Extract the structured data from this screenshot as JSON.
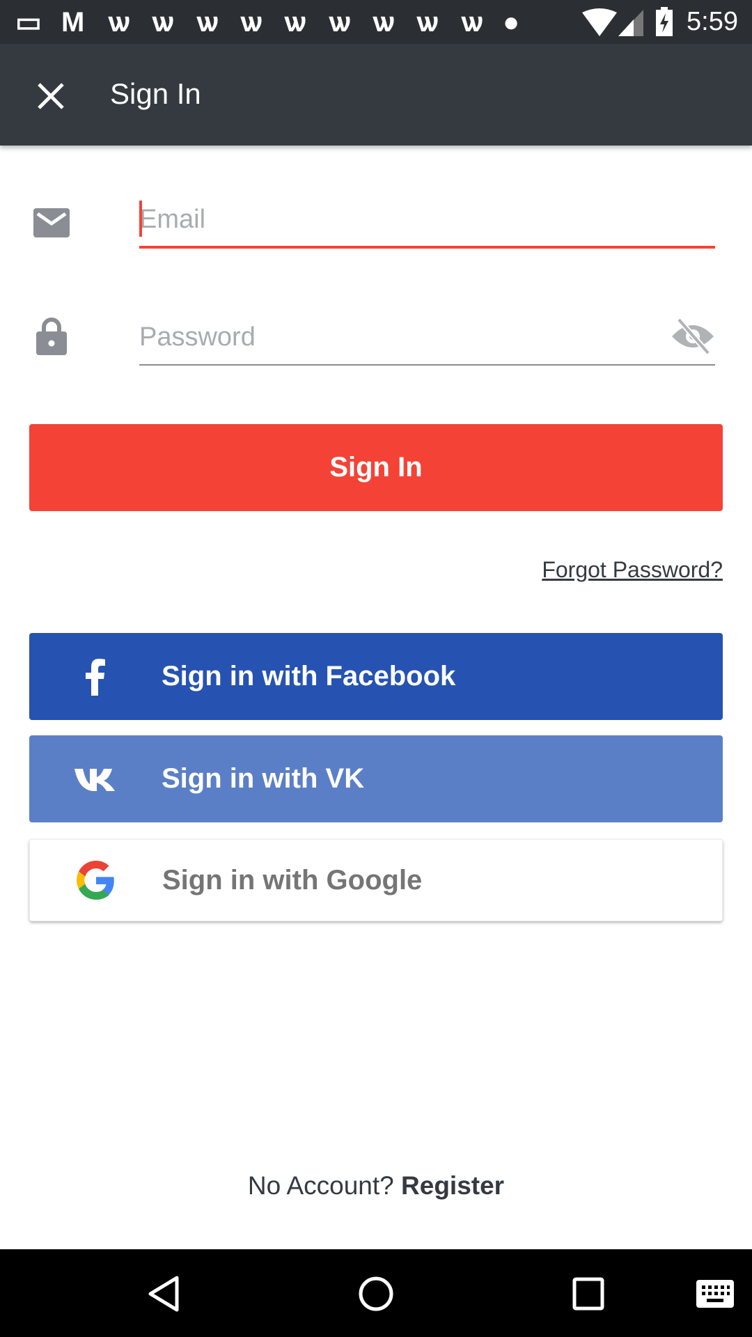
{
  "status_bar": {
    "time": "5:59",
    "icons": [
      "messages-icon",
      "gmail-icon",
      "app-w-icon",
      "app-w-icon",
      "app-w-icon",
      "app-w-icon",
      "app-w-icon",
      "app-w-icon",
      "app-w-icon",
      "app-w-icon",
      "app-w-icon",
      "chat-icon",
      "wifi-icon",
      "signal-icon",
      "battery-charging-icon"
    ]
  },
  "toolbar": {
    "title": "Sign In",
    "close_icon": "close-icon"
  },
  "form": {
    "email_placeholder": "Email",
    "password_placeholder": "Password",
    "signin_label": "Sign In",
    "forgot_label": "Forgot Password?"
  },
  "social": {
    "facebook_label": "Sign in with Facebook",
    "vk_label": "Sign in with VK",
    "google_label": "Sign in with Google"
  },
  "footer": {
    "no_account": "No Account?",
    "register": "Register"
  },
  "colors": {
    "accent": "#f44336",
    "toolbar": "#353a41",
    "facebook": "#2653b2",
    "vk": "#5b7fc7"
  }
}
